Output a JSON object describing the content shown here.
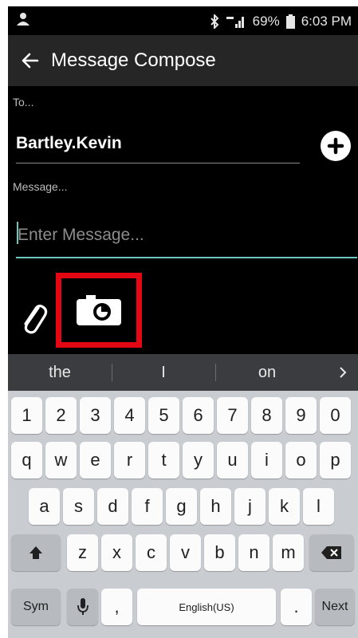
{
  "status_bar": {
    "battery": "69%",
    "time": "6:03 PM"
  },
  "app_bar": {
    "title": "Message Compose"
  },
  "compose": {
    "to_label": "To...",
    "to_value": "Bartley.Kevin",
    "message_label": "Message...",
    "message_placeholder": "Enter Message..."
  },
  "keyboard": {
    "suggestions": [
      "the",
      "I",
      "on"
    ],
    "number_row": [
      "1",
      "2",
      "3",
      "4",
      "5",
      "6",
      "7",
      "8",
      "9",
      "0"
    ],
    "row1": [
      "q",
      "w",
      "e",
      "r",
      "t",
      "y",
      "u",
      "i",
      "o",
      "p"
    ],
    "row2": [
      "a",
      "s",
      "d",
      "f",
      "g",
      "h",
      "j",
      "k",
      "l"
    ],
    "row3": [
      "z",
      "x",
      "c",
      "v",
      "b",
      "n",
      "m"
    ],
    "sym_label": "Sym",
    "comma_label": ",",
    "space_label": "English(US)",
    "period_label": ".",
    "next_label": "Next"
  }
}
